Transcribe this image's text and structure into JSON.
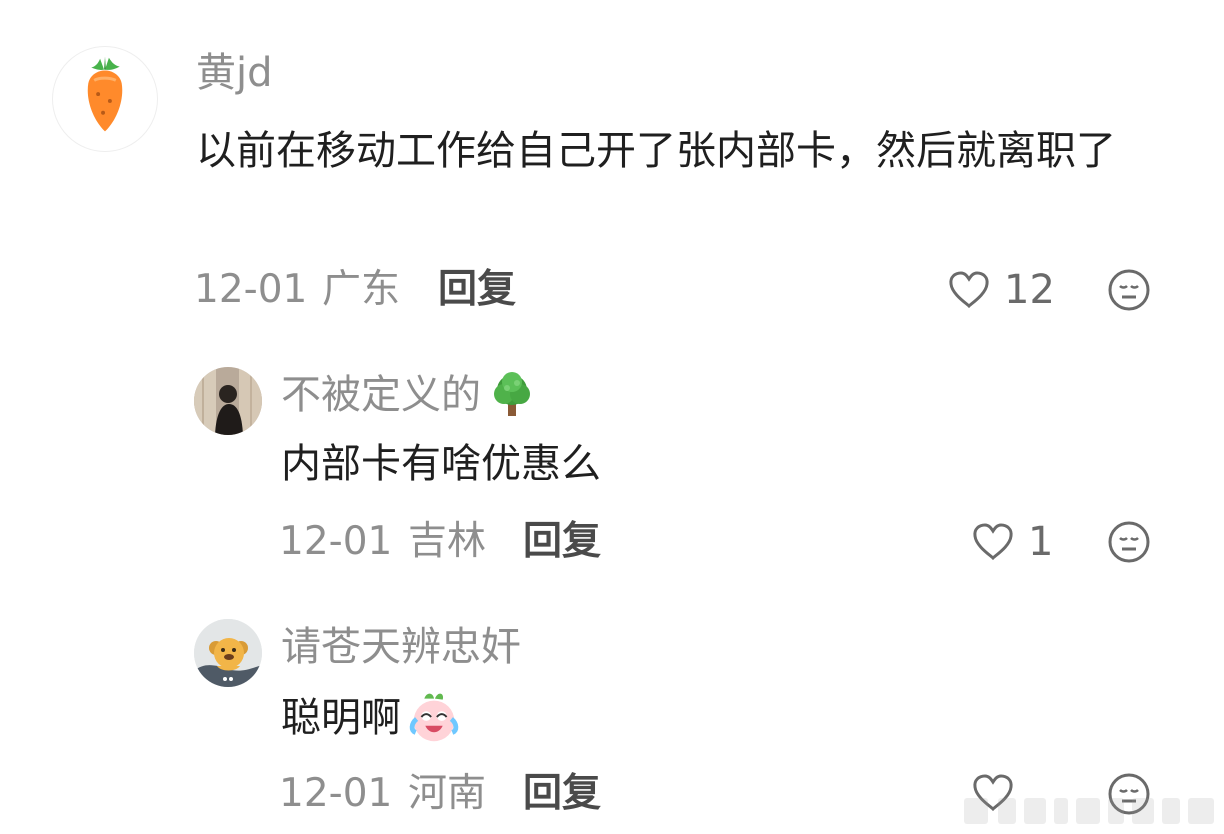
{
  "comments": [
    {
      "username": "黄jd",
      "text": "以前在移动工作给自己开了张内部卡，然后就离职了",
      "date": "12-01",
      "location": "广东",
      "reply_label": "回复",
      "likes": "12",
      "avatar": "carrot-avatar"
    },
    {
      "username": "不被定义的",
      "username_emoji": "tree-emoji",
      "text": "内部卡有啥优惠么",
      "date": "12-01",
      "location": "吉林",
      "reply_label": "回复",
      "likes": "1",
      "avatar": "photo-avatar"
    },
    {
      "username": "请苍天辨忠奸",
      "text": "聪明啊",
      "text_emoji": "crying-laughing-sticker",
      "date": "12-01",
      "location": "河南",
      "reply_label": "回复",
      "likes": "",
      "avatar": "cartoon-dog-avatar"
    }
  ],
  "colors": {
    "background": "#ffffff",
    "username": "#8e8e8e",
    "body_text": "#1f1f1f",
    "meta": "#8e8e8e",
    "reply": "#4a4a4a",
    "icons": "#6a6a6a"
  }
}
